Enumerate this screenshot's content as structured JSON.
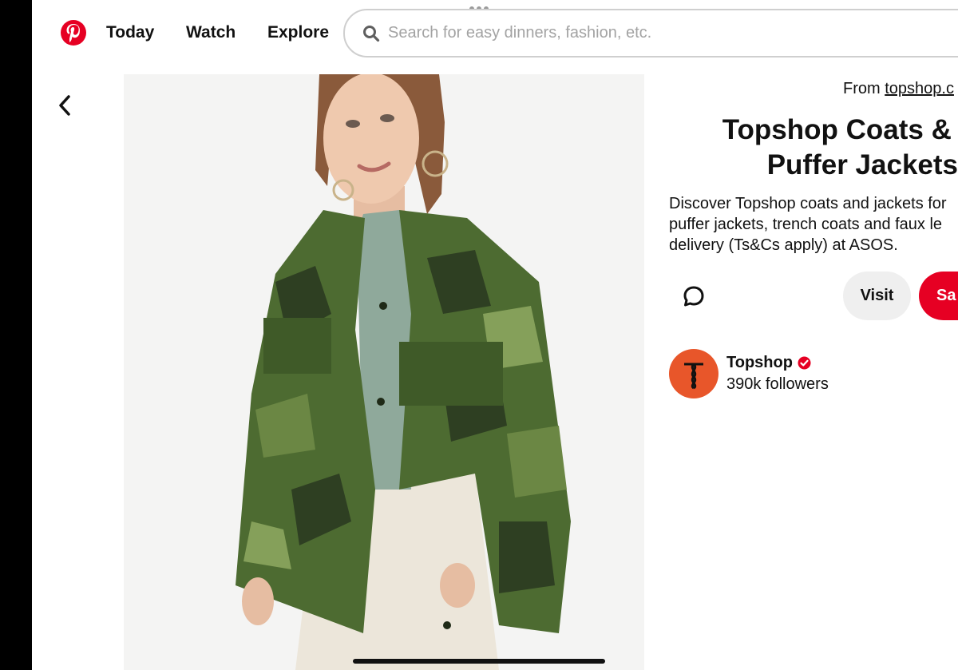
{
  "nav": {
    "logo": "pinterest-logo",
    "items": [
      {
        "label": "Today"
      },
      {
        "label": "Watch"
      },
      {
        "label": "Explore"
      }
    ]
  },
  "search": {
    "placeholder": "Search for easy dinners, fashion, etc.",
    "value": ""
  },
  "pin": {
    "source_prefix": "From ",
    "source_link": "topshop.c",
    "title_line1": "Topshop Coats & Jac",
    "title_line2": "Puffer Jackets",
    "description_lines": [
      "Discover Topshop coats and jackets for",
      "puffer jackets, trench coats and faux le",
      "delivery (Ts&Cs apply) at ASOS."
    ],
    "visit_label": "Visit",
    "save_label": "Sa"
  },
  "profile": {
    "name": "Topshop",
    "followers": "390k followers"
  },
  "colors": {
    "brand_red": "#e60023",
    "avatar_orange": "#e8562a",
    "visit_gray": "#efefef"
  },
  "icons": [
    "search-icon",
    "chevron-left-icon",
    "comment-icon",
    "verified-icon"
  ]
}
